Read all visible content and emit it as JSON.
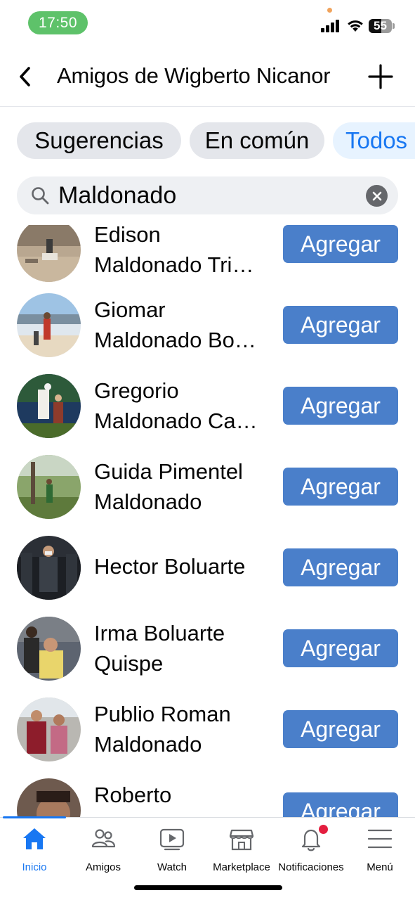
{
  "status_bar": {
    "time": "17:50",
    "battery": "55",
    "battery_level": 0.55
  },
  "header": {
    "back_icon": "chevron-left-icon",
    "title": "Amigos de Wigberto Nicanor",
    "add_icon": "plus-icon"
  },
  "chips": [
    {
      "label": "Sugerencias",
      "active": false
    },
    {
      "label": "En común",
      "active": false
    },
    {
      "label": "Todos",
      "active": true
    }
  ],
  "search": {
    "value": "Maldonado",
    "icon": "search-icon",
    "clear_icon": "clear-icon"
  },
  "people": [
    {
      "name_line1": "Edison",
      "name_line2": "Maldonado Tri…",
      "button": "Agregar"
    },
    {
      "name_line1": "Giomar",
      "name_line2": "Maldonado Bo…",
      "button": "Agregar"
    },
    {
      "name_line1": "Gregorio",
      "name_line2": "Maldonado Ca…",
      "button": "Agregar"
    },
    {
      "name_line1": "Guida Pimentel",
      "name_line2": "Maldonado",
      "button": "Agregar"
    },
    {
      "name_line1": "Hector Boluarte",
      "name_line2": "",
      "button": "Agregar"
    },
    {
      "name_line1": "Irma Boluarte",
      "name_line2": "Quispe",
      "button": "Agregar"
    },
    {
      "name_line1": "Publio Roman",
      "name_line2": "Maldonado",
      "button": "Agregar"
    },
    {
      "name_line1": "Roberto",
      "name_line2": "",
      "button": "Agregar"
    }
  ],
  "tabbar": {
    "items": [
      {
        "label": "Inicio",
        "icon": "home-icon",
        "active": true
      },
      {
        "label": "Amigos",
        "icon": "friends-icon",
        "active": false
      },
      {
        "label": "Watch",
        "icon": "watch-icon",
        "active": false
      },
      {
        "label": "Marketplace",
        "icon": "marketplace-icon",
        "active": false
      },
      {
        "label": "Notificaciones",
        "icon": "bell-icon",
        "active": false,
        "badge": true
      },
      {
        "label": "Menú",
        "icon": "menu-icon",
        "active": false
      }
    ]
  },
  "colors": {
    "accent": "#1877f2",
    "button": "#4a7fca",
    "status_pill": "#5ec26a",
    "badge": "#e41e3f"
  }
}
